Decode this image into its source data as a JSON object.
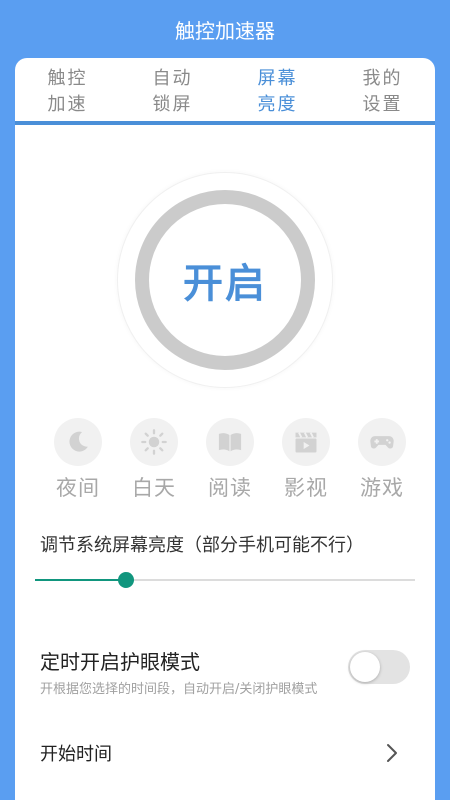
{
  "app": {
    "title": "触控加速器"
  },
  "tabs": [
    {
      "line1": "触控",
      "line2": "加速"
    },
    {
      "line1": "自动",
      "line2": "锁屏"
    },
    {
      "line1": "屏幕",
      "line2": "亮度"
    },
    {
      "line1": "我的",
      "line2": "设置"
    }
  ],
  "active_tab": 2,
  "power": {
    "label": "开启"
  },
  "modes": [
    {
      "label": "夜间",
      "icon": "moon-icon"
    },
    {
      "label": "白天",
      "icon": "sun-icon"
    },
    {
      "label": "阅读",
      "icon": "book-icon"
    },
    {
      "label": "影视",
      "icon": "film-icon"
    },
    {
      "label": "游戏",
      "icon": "gamepad-icon"
    }
  ],
  "brightness": {
    "label": "调节系统屏幕亮度（部分手机可能不行）",
    "level": 0.24
  },
  "eye_care": {
    "title": "定时开启护眼模式",
    "description": "开根据您选择的时间段，自动开启/关闭护眼模式",
    "enabled": false
  },
  "start_time": {
    "label": "开始时间"
  },
  "colors": {
    "brand": "#5a9ef1",
    "accent": "#4a8fd8",
    "slider": "#11967e",
    "ring": "#cbcbcb"
  }
}
